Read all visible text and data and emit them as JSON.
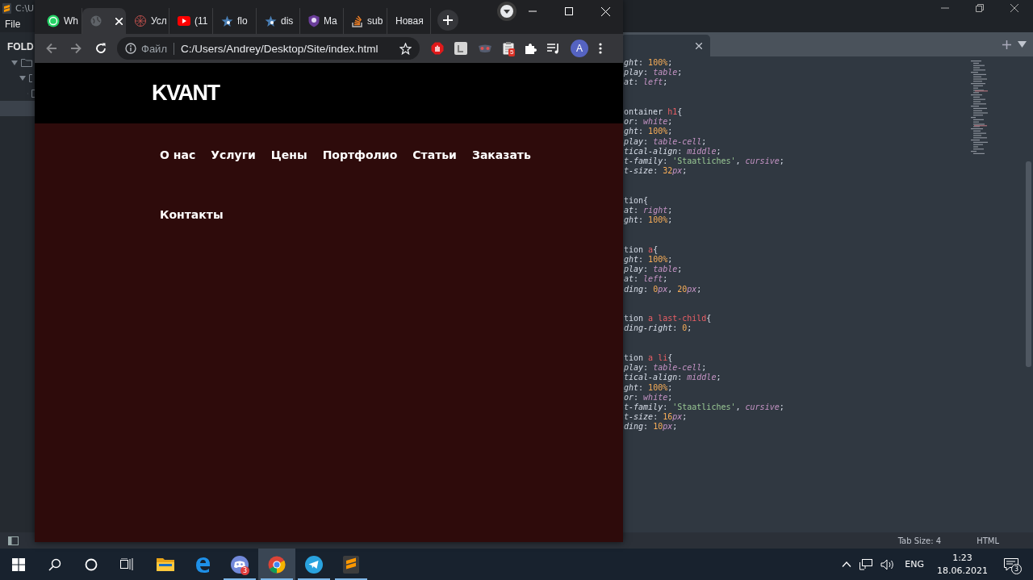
{
  "editor": {
    "title": "C:\\U",
    "menu": [
      "File"
    ],
    "sidebar": {
      "title": "FOLD",
      "tree": [
        {
          "kind": "folder",
          "expanded": true,
          "selected": false,
          "children": [
            {
              "kind": "folder",
              "expanded": true,
              "selected": false,
              "children": [
                {
                  "kind": "folder",
                  "expanded": false,
                  "selected": false
                },
                {
                  "kind": "file",
                  "selected": true
                }
              ]
            }
          ]
        }
      ]
    },
    "code_blocks": [
      {
        "lines": [
          [
            {
              "text": "ght",
              "kind": "prop"
            },
            {
              "text": ": ",
              "kind": "p"
            },
            {
              "text": "100%",
              "kind": "num"
            },
            {
              "text": ";",
              "kind": "p"
            }
          ],
          [
            {
              "text": "play",
              "kind": "prop"
            },
            {
              "text": ": ",
              "kind": "p"
            },
            {
              "text": "table",
              "kind": "kw"
            },
            {
              "text": ";",
              "kind": "p"
            }
          ],
          [
            {
              "text": "at",
              "kind": "prop"
            },
            {
              "text": ": ",
              "kind": "p"
            },
            {
              "text": "left",
              "kind": "kw"
            },
            {
              "text": ";",
              "kind": "p"
            }
          ]
        ]
      },
      {
        "lines": [
          [
            {
              "text": "ontainer ",
              "kind": "sel"
            },
            {
              "text": "h1",
              "kind": "tag"
            },
            {
              "text": "{",
              "kind": "p"
            }
          ],
          [
            {
              "text": "or",
              "kind": "prop"
            },
            {
              "text": ": ",
              "kind": "p"
            },
            {
              "text": "white",
              "kind": "kw"
            },
            {
              "text": ";",
              "kind": "p"
            }
          ],
          [
            {
              "text": "ght",
              "kind": "prop"
            },
            {
              "text": ": ",
              "kind": "p"
            },
            {
              "text": "100%",
              "kind": "num"
            },
            {
              "text": ";",
              "kind": "p"
            }
          ],
          [
            {
              "text": "play",
              "kind": "prop"
            },
            {
              "text": ": ",
              "kind": "p"
            },
            {
              "text": "table-cell",
              "kind": "kw"
            },
            {
              "text": ";",
              "kind": "p"
            }
          ],
          [
            {
              "text": "tical-align",
              "kind": "prop"
            },
            {
              "text": ": ",
              "kind": "p"
            },
            {
              "text": "middle",
              "kind": "kw"
            },
            {
              "text": ";",
              "kind": "p"
            }
          ],
          [
            {
              "text": "t-family",
              "kind": "prop"
            },
            {
              "text": ": ",
              "kind": "p"
            },
            {
              "text": "'Staatliches'",
              "kind": "str"
            },
            {
              "text": ", ",
              "kind": "p"
            },
            {
              "text": "cursive",
              "kind": "kw"
            },
            {
              "text": ";",
              "kind": "p"
            }
          ],
          [
            {
              "text": "t-size",
              "kind": "prop"
            },
            {
              "text": ": ",
              "kind": "p"
            },
            {
              "text": "32",
              "kind": "num"
            },
            {
              "text": "px",
              "kind": "kw"
            },
            {
              "text": ";",
              "kind": "p"
            }
          ]
        ]
      },
      {
        "lines": [
          [
            {
              "text": "tion",
              "kind": "sel"
            },
            {
              "text": "{",
              "kind": "p"
            }
          ],
          [
            {
              "text": "at",
              "kind": "prop"
            },
            {
              "text": ": ",
              "kind": "p"
            },
            {
              "text": "right",
              "kind": "kw"
            },
            {
              "text": ";",
              "kind": "p"
            }
          ],
          [
            {
              "text": "ght",
              "kind": "prop"
            },
            {
              "text": ": ",
              "kind": "p"
            },
            {
              "text": "100%",
              "kind": "num"
            },
            {
              "text": ";",
              "kind": "p"
            }
          ]
        ]
      },
      {
        "lines": [
          [
            {
              "text": "tion ",
              "kind": "sel"
            },
            {
              "text": "a",
              "kind": "tag"
            },
            {
              "text": "{",
              "kind": "p"
            }
          ],
          [
            {
              "text": "ght",
              "kind": "prop"
            },
            {
              "text": ": ",
              "kind": "p"
            },
            {
              "text": "100%",
              "kind": "num"
            },
            {
              "text": ";",
              "kind": "p"
            }
          ],
          [
            {
              "text": "play",
              "kind": "prop"
            },
            {
              "text": ": ",
              "kind": "p"
            },
            {
              "text": "table",
              "kind": "kw"
            },
            {
              "text": ";",
              "kind": "p"
            }
          ],
          [
            {
              "text": "at",
              "kind": "prop"
            },
            {
              "text": ": ",
              "kind": "p"
            },
            {
              "text": "left",
              "kind": "kw"
            },
            {
              "text": ";",
              "kind": "p"
            }
          ],
          [
            {
              "text": "ding",
              "kind": "prop"
            },
            {
              "text": ": ",
              "kind": "p"
            },
            {
              "text": "0",
              "kind": "num"
            },
            {
              "text": "px",
              "kind": "kw"
            },
            {
              "text": ", ",
              "kind": "p"
            },
            {
              "text": "20",
              "kind": "num"
            },
            {
              "text": "px",
              "kind": "kw"
            },
            {
              "text": ";",
              "kind": "p"
            }
          ]
        ]
      },
      {
        "lines": [
          [
            {
              "text": "tion ",
              "kind": "sel"
            },
            {
              "text": "a last-child",
              "kind": "tag"
            },
            {
              "text": "{",
              "kind": "p"
            }
          ],
          [
            {
              "text": "ding-right",
              "kind": "prop"
            },
            {
              "text": ": ",
              "kind": "p"
            },
            {
              "text": "0",
              "kind": "num"
            },
            {
              "text": ";",
              "kind": "p"
            }
          ]
        ]
      },
      {
        "lines": [
          [
            {
              "text": "tion ",
              "kind": "sel"
            },
            {
              "text": "a li",
              "kind": "tag"
            },
            {
              "text": "{",
              "kind": "p"
            }
          ],
          [
            {
              "text": "play",
              "kind": "prop"
            },
            {
              "text": ": ",
              "kind": "p"
            },
            {
              "text": "table-cell",
              "kind": "kw"
            },
            {
              "text": ";",
              "kind": "p"
            }
          ],
          [
            {
              "text": "tical-align",
              "kind": "prop"
            },
            {
              "text": ": ",
              "kind": "p"
            },
            {
              "text": "middle",
              "kind": "kw"
            },
            {
              "text": ";",
              "kind": "p"
            }
          ],
          [
            {
              "text": "ght",
              "kind": "prop"
            },
            {
              "text": ": ",
              "kind": "p"
            },
            {
              "text": "100%",
              "kind": "num"
            },
            {
              "text": ";",
              "kind": "p"
            }
          ],
          [
            {
              "text": "or",
              "kind": "prop"
            },
            {
              "text": ": ",
              "kind": "p"
            },
            {
              "text": "white",
              "kind": "kw"
            },
            {
              "text": ";",
              "kind": "p"
            }
          ],
          [
            {
              "text": "t-family",
              "kind": "prop"
            },
            {
              "text": ": ",
              "kind": "p"
            },
            {
              "text": "'Staatliches'",
              "kind": "str"
            },
            {
              "text": ", ",
              "kind": "p"
            },
            {
              "text": "cursive",
              "kind": "kw"
            },
            {
              "text": ";",
              "kind": "p"
            }
          ],
          [
            {
              "text": "t-size",
              "kind": "prop"
            },
            {
              "text": ": ",
              "kind": "p"
            },
            {
              "text": "16",
              "kind": "num"
            },
            {
              "text": "px",
              "kind": "kw"
            },
            {
              "text": ";",
              "kind": "p"
            }
          ],
          [
            {
              "text": "ding",
              "kind": "prop"
            },
            {
              "text": ": ",
              "kind": "p"
            },
            {
              "text": "10",
              "kind": "num"
            },
            {
              "text": "px",
              "kind": "kw"
            },
            {
              "text": ";",
              "kind": "p"
            }
          ]
        ]
      }
    ],
    "status_bar": {
      "tab_size": "Tab Size: 4",
      "syntax": "HTML"
    }
  },
  "browser": {
    "tabs": [
      {
        "title": "Wh",
        "selected": false
      },
      {
        "selected": true
      },
      {
        "title": "Усл",
        "selected": false
      },
      {
        "title": "(11",
        "selected": false
      },
      {
        "title": "flo",
        "selected": false
      },
      {
        "title": "dis",
        "selected": false
      },
      {
        "title": "Ma",
        "selected": false
      },
      {
        "title": "sub",
        "selected": false
      },
      {
        "title": "Новая",
        "selected": false
      }
    ],
    "address": {
      "scheme": "Файл",
      "url": "C:/Users/Andrey/Desktop/Site/index.html"
    },
    "extension_badge": "5",
    "avatar": "A",
    "page": {
      "logo": "KVANT",
      "nav": [
        "О нас",
        "Услуги",
        "Цены",
        "Портфолио",
        "Статьи",
        "Заказать",
        "Контакты"
      ]
    }
  },
  "taskbar": {
    "apps": [
      {
        "open": false,
        "selected": false
      },
      {
        "open": false,
        "selected": false
      },
      {
        "open": true,
        "selected": false,
        "badge": "3"
      },
      {
        "open": true,
        "selected": true
      },
      {
        "open": true,
        "selected": false
      },
      {
        "open": true,
        "selected": false
      }
    ],
    "tray": {
      "language": "ENG",
      "time": "1:23",
      "date": "18.06.2021",
      "notifications": "3"
    }
  }
}
